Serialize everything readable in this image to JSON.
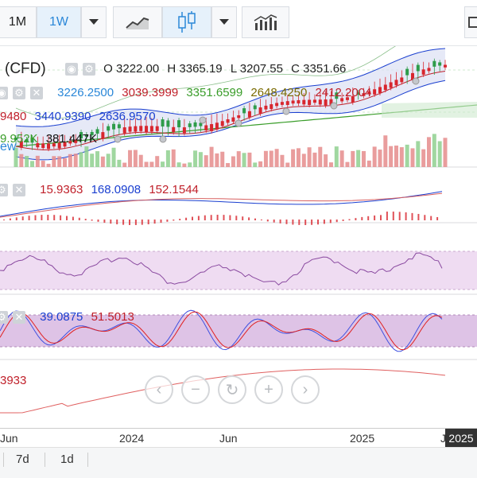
{
  "toolbar": {
    "periods": [
      {
        "label": "1M",
        "active": false
      },
      {
        "label": "1W",
        "active": true
      }
    ]
  },
  "instrument": {
    "name_partial": "(CFD)"
  },
  "ohlc": {
    "o": "O 3222.00",
    "h": "H 3365.19",
    "l": "L 3207.55",
    "c": "C 3351.66"
  },
  "bbands": {
    "mid": "3226.2500",
    "upper": "3039.3999",
    "lower": "3351.6599",
    "v4": "2648.4250",
    "v5": "2412.2004"
  },
  "ichimoku": {
    "a": "9480",
    "b": "3440.9390",
    "c": "2636.9570"
  },
  "volume": {
    "a": "9.952K",
    "b": "381.447K",
    "suffix": "ew"
  },
  "macd": {
    "v1": "15.9363",
    "v2": "168.0908",
    "v3": "152.1544"
  },
  "stoch": {
    "v1": "39.0875",
    "v2": "51.5013"
  },
  "bottom_ind": {
    "v1": "3933"
  },
  "xaxis": {
    "labels": [
      "Jun",
      "2024",
      "Jun",
      "2025",
      "J"
    ],
    "current": "2025"
  },
  "footer": {
    "ranges": [
      "7d",
      "1d"
    ]
  },
  "colors": {
    "up": "#2e9c4a",
    "down": "#d8262e",
    "blue": "#3f51e0",
    "red": "#e02020",
    "green": "#2a9d2a",
    "purple_band": "#efdcf2"
  }
}
